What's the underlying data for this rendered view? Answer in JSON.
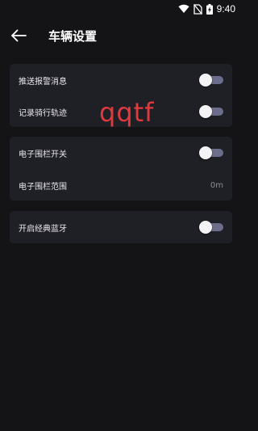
{
  "status_bar": {
    "time": "9:40",
    "icons": [
      "wifi-icon",
      "no-sim-icon",
      "battery-charging-icon"
    ]
  },
  "header": {
    "back_icon": "arrow-left-icon",
    "title": "车辆设置"
  },
  "settings": {
    "group1": [
      {
        "label": "推送报警消息",
        "type": "toggle",
        "checked": false
      },
      {
        "label": "记录骑行轨迹",
        "type": "toggle",
        "checked": false
      }
    ],
    "group2": [
      {
        "label": "电子围栏开关",
        "type": "toggle",
        "checked": false
      },
      {
        "label": "电子围栏范围",
        "type": "value",
        "value": "0m"
      }
    ],
    "group3": [
      {
        "label": "开启经典蓝牙",
        "type": "toggle",
        "checked": false
      }
    ]
  },
  "overlay": {
    "watermark_text": "qqtf",
    "watermark_color": "#e0393e"
  },
  "colors": {
    "background": "#141417",
    "card": "#1f1f26",
    "toggle_track": "#6b6d8a",
    "toggle_thumb": "#f4f4f6"
  }
}
